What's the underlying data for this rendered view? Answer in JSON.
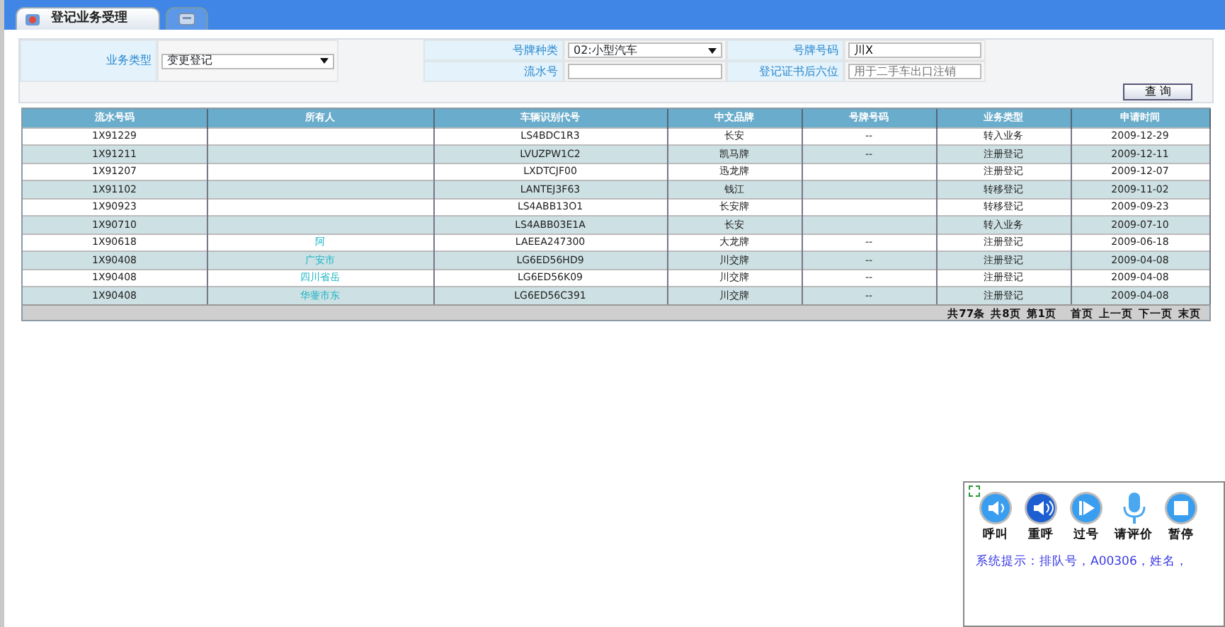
{
  "tabs": [
    {
      "label": "登记业务受理",
      "selected": true
    },
    {
      "kind": "icon",
      "selected": false
    }
  ],
  "form": {
    "business_type": {
      "label": "业务类型",
      "value": "变更登记"
    },
    "plate_type": {
      "label": "号牌种类",
      "value": "02:小型汽车"
    },
    "plate_number": {
      "label": "号牌号码",
      "value": "川X"
    },
    "serial_number": {
      "label": "流水号"
    },
    "cert_last_six": {
      "label": "登记证书后六位",
      "placeholder": "用于二手车出口注销"
    },
    "query_button": "查 询"
  },
  "table": {
    "columns": [
      "流水号码",
      "所有人",
      "车辆识别代号",
      "中文品牌",
      "号牌号码",
      "业务类型",
      "申请时间"
    ],
    "rows": [
      {
        "serial": "1X91229",
        "vin": "LS4BDC1R3",
        "brand": "长安",
        "plate": "--",
        "type": "转入业务",
        "date": "2009-12-29"
      },
      {
        "serial": "1X91211",
        "vin": "LVUZPW1C2",
        "brand": "凯马牌",
        "plate": "--",
        "type": "注册登记",
        "date": "2009-12-11"
      },
      {
        "serial": "1X91207",
        "vin": "LXDTCJF00",
        "brand": "迅龙牌",
        "type": "注册登记",
        "date": "2009-12-07"
      },
      {
        "serial": "1X91102",
        "vin": "LANTEJ3F63",
        "brand": "钱江",
        "type": "转移登记",
        "date": "2009-11-02"
      },
      {
        "serial": "1X90923",
        "vin": "LS4ABB13O1",
        "brand": "长安牌",
        "type": "转移登记",
        "date": "2009-09-23"
      },
      {
        "serial": "1X90710",
        "vin": "LS4ABB03E1A",
        "brand": "长安",
        "type": "转入业务",
        "date": "2009-07-10"
      },
      {
        "serial": "1X90618",
        "owner": "阿",
        "vin": "LAEEA247300",
        "brand": "大龙牌",
        "plate": "--",
        "type": "注册登记",
        "date": "2009-06-18"
      },
      {
        "serial": "1X90408",
        "owner": "广安市",
        "vin": "LG6ED56HD9",
        "brand": "川交牌",
        "plate": "--",
        "type": "注册登记",
        "date": "2009-04-08"
      },
      {
        "serial": "1X90408",
        "owner": "四川省岳",
        "vin": "LG6ED56K09",
        "brand": "川交牌",
        "plate": "--",
        "type": "注册登记",
        "date": "2009-04-08"
      },
      {
        "serial": "1X90408",
        "owner": "华蓥市东",
        "vin": "LG6ED56C391",
        "brand": "川交牌",
        "plate": "--",
        "type": "注册登记",
        "date": "2009-04-08"
      }
    ],
    "pager": [
      "共77条",
      "共8页",
      "第1页",
      "首页",
      "上一页",
      "下一页",
      "末页"
    ]
  },
  "queue_panel": {
    "buttons": [
      {
        "kind": "speaker",
        "label": "呼叫"
      },
      {
        "kind": "speaker-dark",
        "label": "重呼"
      },
      {
        "kind": "play",
        "label": "过号"
      },
      {
        "kind": "mic",
        "label": "请评价"
      },
      {
        "kind": "stop",
        "label": "暂停"
      }
    ],
    "message": "系统提示：排队号，A00306，姓名，"
  }
}
